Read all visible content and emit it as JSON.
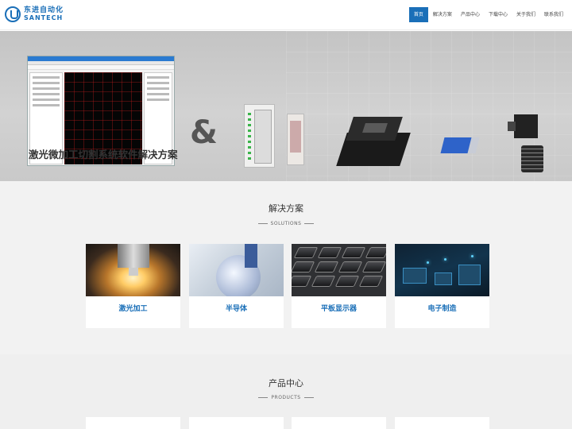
{
  "header": {
    "logo_cn": "东进自动化",
    "logo_en": "SANTECH",
    "nav": [
      "首页",
      "解决方案",
      "产品中心",
      "下载中心",
      "关于我们",
      "联系我们"
    ],
    "active_nav": "首页"
  },
  "banner": {
    "caption": "激光微加工切割系统软件解决方案",
    "ampersand": "&",
    "active_slide": 1,
    "slide_count": 3
  },
  "solutions": {
    "title": "解决方案",
    "subtitle": "SOLUTIONS",
    "items": [
      {
        "label": "激光加工"
      },
      {
        "label": "半导体"
      },
      {
        "label": "平板显示器"
      },
      {
        "label": "电子制造"
      }
    ]
  },
  "products": {
    "title": "产品中心",
    "subtitle": "PRODUCTS"
  },
  "colors": {
    "accent": "#1a6fb8",
    "banner_bg": "#cccccc",
    "section_bg": "#f2f2f2"
  }
}
